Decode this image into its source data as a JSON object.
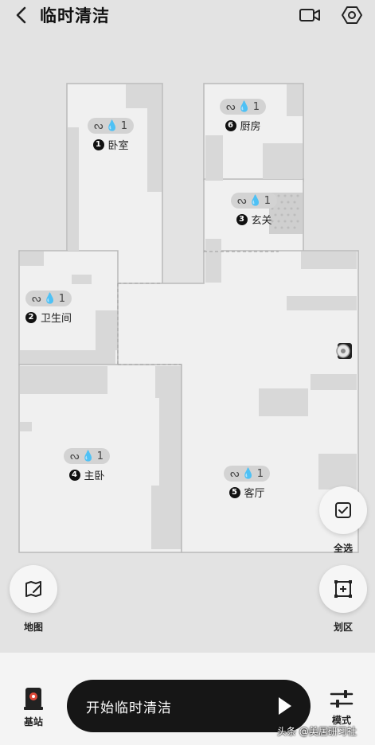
{
  "header": {
    "title": "临时清洁"
  },
  "rooms": [
    {
      "number": "1",
      "name": "卧室",
      "level": "1"
    },
    {
      "number": "6",
      "name": "厨房",
      "level": "1"
    },
    {
      "number": "3",
      "name": "玄关",
      "level": "1"
    },
    {
      "number": "2",
      "name": "卫生间",
      "level": "1"
    },
    {
      "number": "4",
      "name": "主卧",
      "level": "1"
    },
    {
      "number": "5",
      "name": "客厅",
      "level": "1"
    }
  ],
  "actions": {
    "select_all": "全选",
    "zone": "划区",
    "map": "地图"
  },
  "dock": {
    "base_label": "基站",
    "start_label": "开始临时清洁",
    "mode_label": "模式"
  },
  "watermark": "头条 @美居研习社",
  "colors": {
    "room_floor": "#f0f0f0",
    "obstacle": "#d8d8d8",
    "wall": "#b9b9b9",
    "start_button": "#161616"
  }
}
